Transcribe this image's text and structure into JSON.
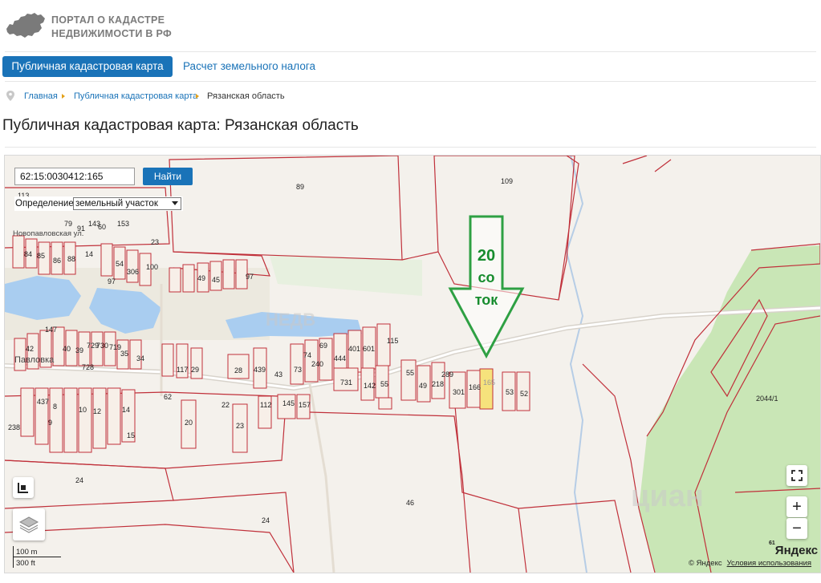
{
  "header": {
    "logo_icon": "russia-map-icon",
    "logo_line1": "ПОРТАЛ О КАДАСТРЕ",
    "logo_line2": "НЕДВИЖИМОСТИ В РФ"
  },
  "nav": {
    "tabs": [
      {
        "label": "Публичная кадастровая карта",
        "active": true
      },
      {
        "label": "Расчет земельного налога",
        "active": false
      }
    ]
  },
  "breadcrumb": {
    "icon": "map-pin-icon",
    "items": [
      "Главная",
      "Публичная кадастровая карта",
      "Рязанская область"
    ]
  },
  "page_title": "Публичная кадастровая карта: Рязанская область",
  "map": {
    "search": {
      "value": "62:15:0030412:165",
      "button_label": "Найти"
    },
    "definition": {
      "label": "Определение:",
      "selected": "земельный участок"
    },
    "annotation": {
      "line1": "20",
      "line2": "со",
      "line3": "ток",
      "color": "#178c2e"
    },
    "street_labels": [
      "Павловка",
      "Новопавловская ул."
    ],
    "plot_labels": [
      "89",
      "109",
      "113",
      "23",
      "84",
      "85",
      "86",
      "88",
      "54",
      "306",
      "100",
      "97",
      "49",
      "45",
      "97",
      "147",
      "40",
      "39",
      "729",
      "730",
      "719",
      "35",
      "34",
      "42",
      "728",
      "117",
      "29",
      "28",
      "439",
      "43",
      "73",
      "240",
      "74",
      "69",
      "444",
      "401",
      "601",
      "115",
      "731",
      "142",
      "55",
      "49",
      "218",
      "289",
      "55",
      "301",
      "166",
      "165",
      "53",
      "52",
      "2044/1",
      "62",
      "22",
      "437",
      "8",
      "10",
      "12",
      "14",
      "15",
      "238",
      "9",
      "20",
      "23",
      "145",
      "157",
      "112",
      "24",
      "24",
      "46",
      "14",
      "79",
      "143",
      "91",
      "60",
      "153"
    ],
    "highlighted_plot": "165",
    "controls": {
      "fullscreen_icon": "fullscreen-icon",
      "zoom_in": "+",
      "zoom_out": "−",
      "ruler_icon": "ruler-icon",
      "layers_icon": "layers-icon"
    },
    "scale": {
      "metric": "100 m",
      "imperial": "300 ft"
    },
    "attribution": {
      "logo": "Яндекс",
      "logo_sup": "61",
      "copyright": "© Яндекс",
      "terms": "Условия использования"
    },
    "watermarks": [
      "НЕДВ",
      "циан"
    ]
  }
}
